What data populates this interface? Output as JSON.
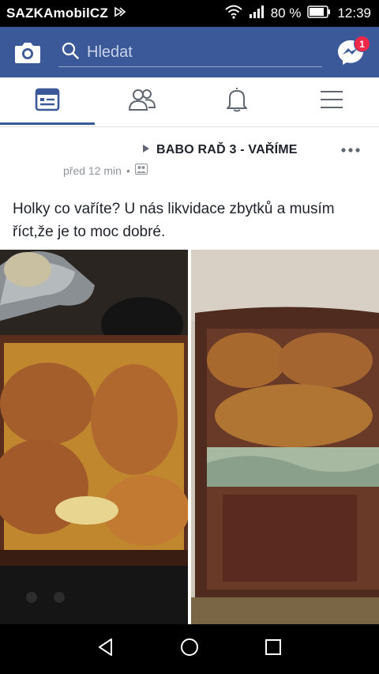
{
  "status_bar": {
    "carrier": "SAZKAmobilCZ",
    "battery": "80 %",
    "time": "12:39"
  },
  "header": {
    "search_placeholder": "Hledat",
    "messenger_badge": "1",
    "accent_color": "#3b5998"
  },
  "tabs": [
    {
      "icon": "news-feed-icon",
      "active": true
    },
    {
      "icon": "friends-icon",
      "active": false
    },
    {
      "icon": "notifications-bell-icon",
      "active": false
    },
    {
      "icon": "menu-icon",
      "active": false
    }
  ],
  "post": {
    "group_name": "BABO RAĎ 3 - VAŘÍME",
    "time": "před 12 min",
    "privacy_icon": "group-icon",
    "text": "Holky co vaříte? U nás likvidace zbytků a musím říct,že je to moc dobré."
  },
  "navigation": [
    {
      "icon": "back-icon"
    },
    {
      "icon": "home-icon"
    },
    {
      "icon": "recents-icon"
    }
  ]
}
